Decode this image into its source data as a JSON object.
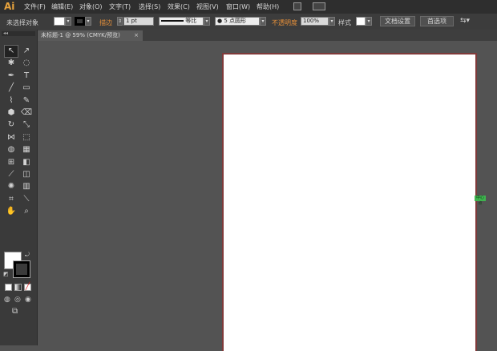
{
  "app": {
    "logo": "Ai"
  },
  "menu": [
    "文件(F)",
    "编辑(E)",
    "对象(O)",
    "文字(T)",
    "选择(S)",
    "效果(C)",
    "视图(V)",
    "窗口(W)",
    "帮助(H)"
  ],
  "menu_icons": [
    "bridge-icon",
    "arrange-documents-icon"
  ],
  "control_bar": {
    "selection_status": "未选择对象",
    "stroke_label": "描边",
    "stroke_weight": "1 pt",
    "stroke_profile": "等比",
    "brush": "● 5 点圆形",
    "opacity_label": "不透明度",
    "opacity_value": "100%",
    "style_label": "样式",
    "document_setup": "文档设置",
    "preferences": "首选项",
    "fill_color": "#ffffff",
    "stroke_color": "#000000",
    "accent_orange": "#e8913a"
  },
  "tab": {
    "title": "未标题-1 @ 59% (CMYK/预览)",
    "close": "×"
  },
  "toolbox": {
    "grip": "◂◂",
    "tools": [
      [
        "selection-tool",
        "↖"
      ],
      [
        "direct-selection-tool",
        "↗"
      ],
      [
        "magic-wand-tool",
        "✱"
      ],
      [
        "lasso-tool",
        "◌"
      ],
      [
        "pen-tool",
        "✒"
      ],
      [
        "type-tool",
        "T"
      ],
      [
        "line-segment-tool",
        "╱"
      ],
      [
        "rectangle-tool",
        "▭"
      ],
      [
        "paintbrush-tool",
        "⌇"
      ],
      [
        "pencil-tool",
        "✎"
      ],
      [
        "blob-brush-tool",
        "⬢"
      ],
      [
        "eraser-tool",
        "⌫"
      ],
      [
        "rotate-tool",
        "↻"
      ],
      [
        "scale-tool",
        "⤡"
      ],
      [
        "width-tool",
        "⋈"
      ],
      [
        "free-transform-tool",
        "⬚"
      ],
      [
        "shape-builder-tool",
        "◍"
      ],
      [
        "perspective-grid-tool",
        "▦"
      ],
      [
        "mesh-tool",
        "⊞"
      ],
      [
        "gradient-tool",
        "◧"
      ],
      [
        "eyedropper-tool",
        "⟋"
      ],
      [
        "blend-tool",
        "◫"
      ],
      [
        "symbol-sprayer-tool",
        "✺"
      ],
      [
        "column-graph-tool",
        "▥"
      ],
      [
        "artboard-tool",
        "⌗"
      ],
      [
        "slice-tool",
        "⟍"
      ],
      [
        "hand-tool",
        "✋"
      ],
      [
        "zoom-tool",
        "⌕"
      ]
    ]
  },
  "canvas": {
    "artboard_fill": "#ffffff",
    "artboard_border": "#7f3a3a",
    "center_label": "中心点"
  }
}
